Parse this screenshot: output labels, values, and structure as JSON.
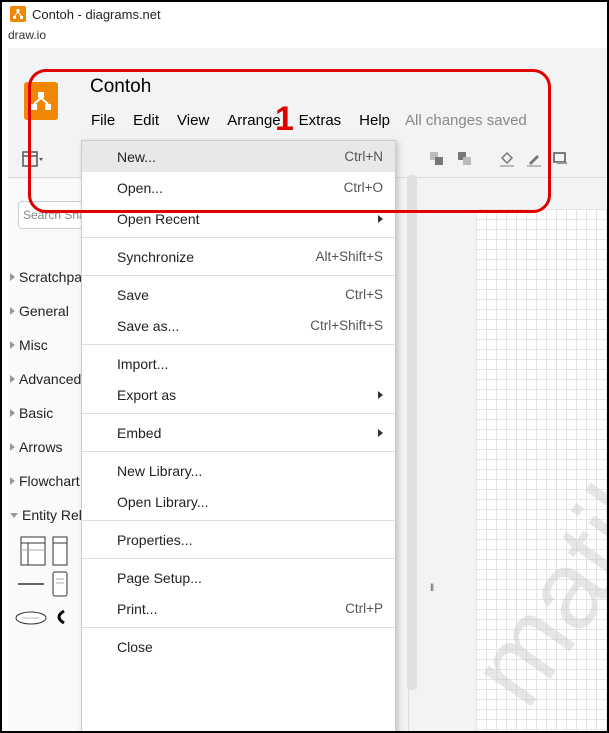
{
  "window": {
    "title": "Contoh - diagrams.net",
    "url_label": "draw.io"
  },
  "header": {
    "doc_title": "Contoh",
    "menus": [
      "File",
      "Edit",
      "View",
      "Arrange",
      "Extras",
      "Help"
    ],
    "status": "All changes saved"
  },
  "sidebar": {
    "search_placeholder": "Search Shapes",
    "items": [
      "Scratchpad",
      "General",
      "Misc",
      "Advanced",
      "Basic",
      "Arrows",
      "Flowchart",
      "Entity Relation"
    ]
  },
  "file_menu": {
    "new": {
      "label": "New...",
      "shortcut": "Ctrl+N"
    },
    "open": {
      "label": "Open...",
      "shortcut": "Ctrl+O"
    },
    "open_recent": {
      "label": "Open Recent"
    },
    "synchronize": {
      "label": "Synchronize",
      "shortcut": "Alt+Shift+S"
    },
    "save": {
      "label": "Save",
      "shortcut": "Ctrl+S"
    },
    "save_as": {
      "label": "Save as...",
      "shortcut": "Ctrl+Shift+S"
    },
    "import": {
      "label": "Import..."
    },
    "export_as": {
      "label": "Export as"
    },
    "embed": {
      "label": "Embed"
    },
    "new_library": {
      "label": "New Library..."
    },
    "open_library": {
      "label": "Open Library..."
    },
    "properties": {
      "label": "Properties..."
    },
    "page_setup": {
      "label": "Page Setup..."
    },
    "print": {
      "label": "Print...",
      "shortcut": "Ctrl+P"
    },
    "close": {
      "label": "Close"
    }
  },
  "annotation": {
    "number": "1",
    "color": "#e00000"
  },
  "watermark": "matik",
  "colors": {
    "brand": "#f08705",
    "annotation": "#e00000"
  },
  "icons": [
    "drawio-logo-icon",
    "format-panel-icon",
    "to-front-icon",
    "to-back-icon",
    "fill-color-icon",
    "line-color-icon",
    "shadow-icon"
  ]
}
